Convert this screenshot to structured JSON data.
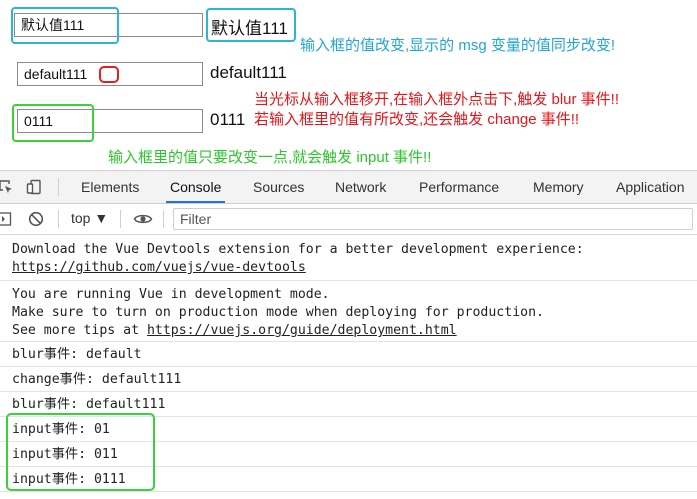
{
  "demo": {
    "row1": {
      "input_value": "默认值111",
      "echo": "默认值111",
      "note": "输入框的值改变,显示的 msg 变量的值同步改变!"
    },
    "row2": {
      "input_value": "default111",
      "echo": "default111",
      "note1": "当光标从输入框移开,在输入框外点击下,触发 blur 事件!!",
      "note2": "若输入框里的值有所改变,还会触发 change 事件!!"
    },
    "row3": {
      "input_value": "0111",
      "echo": "0111",
      "note": "输入框里的值只要改变一点,就会触发 input 事件!!"
    }
  },
  "devtools": {
    "tabs": [
      "Elements",
      "Console",
      "Sources",
      "Network",
      "Performance",
      "Memory",
      "Application"
    ],
    "active_tab": "Console",
    "context": "top ▼",
    "filter_placeholder": "Filter",
    "accent": "#1a73e8"
  },
  "console": {
    "messages": [
      {
        "line1": "Download the Vue Devtools extension for a better development experience:",
        "link": "https://github.com/vuejs/vue-devtools"
      },
      {
        "line1": "You are running Vue in development mode.",
        "line2": "Make sure to turn on production mode when deploying for production.",
        "line3_prefix": "See more tips at ",
        "link": "https://vuejs.org/guide/deployment.html"
      },
      {
        "text": "blur事件: default"
      },
      {
        "text": "change事件: default111"
      },
      {
        "text": "blur事件: default111"
      },
      {
        "text": "input事件: 01"
      },
      {
        "text": "input事件: 011"
      },
      {
        "text": "input事件: 0111"
      }
    ]
  },
  "colors": {
    "blue_highlight": "#2fb3d9",
    "green_highlight": "#3ad13a",
    "red_highlight": "#e02020",
    "note_red": "#e3161b",
    "note_green": "#2ec52e",
    "note_blue": "#23a6cf"
  }
}
